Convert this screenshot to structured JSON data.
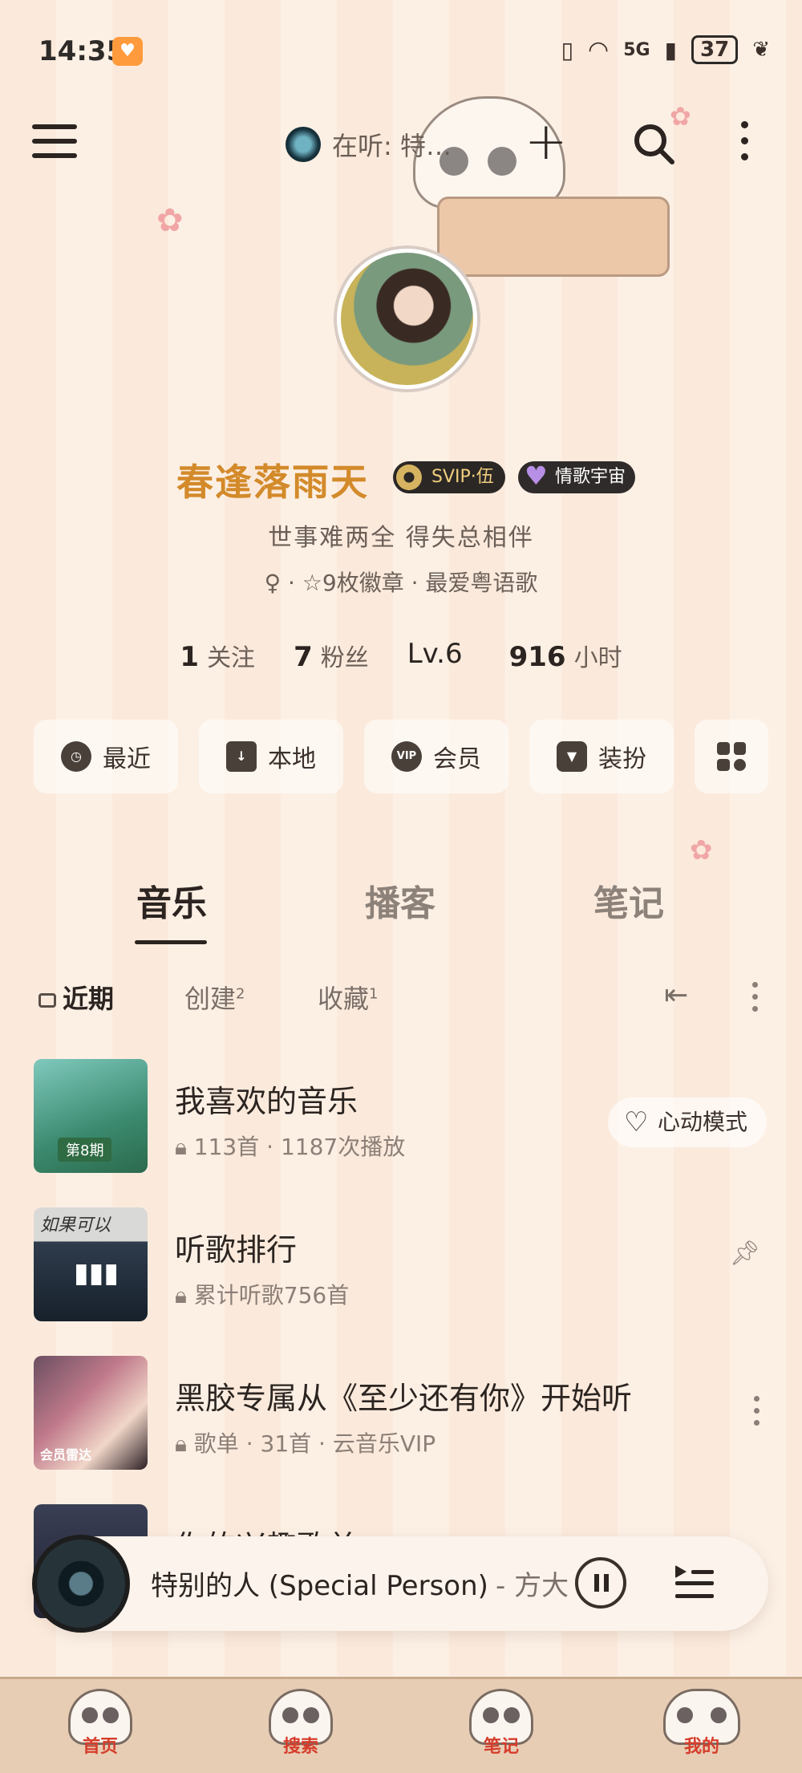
{
  "status_bar": {
    "time": "14:35",
    "network": "5G",
    "battery": "37"
  },
  "topnav": {
    "now_playing_label": "在听: 特…"
  },
  "profile": {
    "nickname": "春逢落雨天",
    "svip_badge": "SVIP·伍",
    "love_badge": "情歌宇宙",
    "signature": "世事难两全 得失总相伴",
    "meta_line": "♀ · ☆9枚徽章 · 最爱粤语歌",
    "stats": {
      "follow_num": "1",
      "follow_label": "关注",
      "fans_num": "7",
      "fans_label": "粉丝",
      "level": "Lv.6",
      "hours_num": "916",
      "hours_label": "小时"
    }
  },
  "quick_buttons": [
    {
      "label": "最近",
      "icon": "clock-icon"
    },
    {
      "label": "本地",
      "icon": "download-icon"
    },
    {
      "label": "会员",
      "icon": "vip-icon",
      "icon_text": "VIP"
    },
    {
      "label": "装扮",
      "icon": "shirt-icon"
    }
  ],
  "tabs": [
    "音乐",
    "播客",
    "笔记"
  ],
  "subtabs": {
    "recent": "近期",
    "created": "创建",
    "created_count": "2",
    "collected": "收藏",
    "collected_count": "1"
  },
  "playlists": [
    {
      "title": "我喜欢的音乐",
      "subtitle": "113首 · 1187次播放",
      "action": "心动模式"
    },
    {
      "title": "听歌排行",
      "subtitle": "累计听歌756首"
    },
    {
      "title": "黑胶专属从《至少还有你》开始听",
      "subtitle": "歌单 · 31首 · 云音乐VIP",
      "cover_label": "会员雷达"
    },
    {
      "title": "你的兴趣歌单",
      "subtitle": ""
    }
  ],
  "cover_texts": {
    "issue": "第8期",
    "rank_cover": "如果可以"
  },
  "player": {
    "track": "特别的人 (Special Person)",
    "artist": "- 方大"
  },
  "bottom_nav": [
    "首页",
    "搜索",
    "笔记",
    "我的"
  ],
  "colors": {
    "accent_name": "#d38a2a",
    "nav_label": "#d53d2b"
  }
}
